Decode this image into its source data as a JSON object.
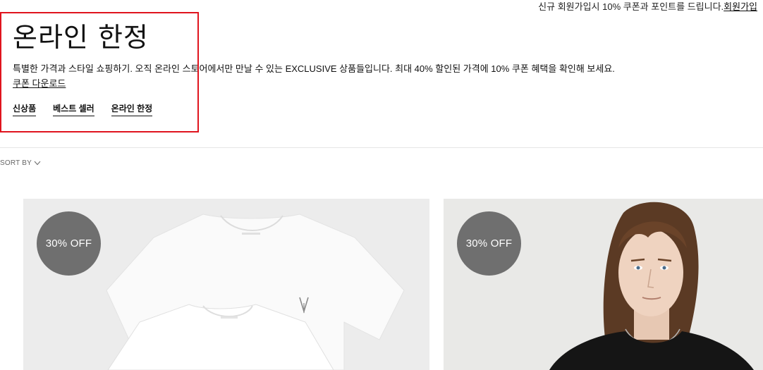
{
  "promo": {
    "text": "신규 회원가입시 10% 쿠폰과 포인트를 드립니다.",
    "link": "회원가입"
  },
  "header": {
    "title": "온라인 한정",
    "description": "특별한 가격과 스타일 쇼핑하기. 오직 온라인 스토어에서만 만날 수 있는 EXCLUSIVE 상품들입니다. 최대 40% 할인된 가격에 10% 쿠폰 혜택을 확인해 보세요.",
    "coupon_link": "쿠폰 다운로드"
  },
  "sub_nav": [
    {
      "label": "신상품"
    },
    {
      "label": "베스트 셀러"
    },
    {
      "label": "온라인 한정"
    }
  ],
  "sort": {
    "label": "SORT BY",
    "icon": "chevron-down-icon"
  },
  "products": [
    {
      "badge": "30% OFF"
    },
    {
      "badge": "30% OFF"
    }
  ],
  "colors": {
    "highlight": "#e0141e",
    "badge": "#6f6f6f"
  }
}
